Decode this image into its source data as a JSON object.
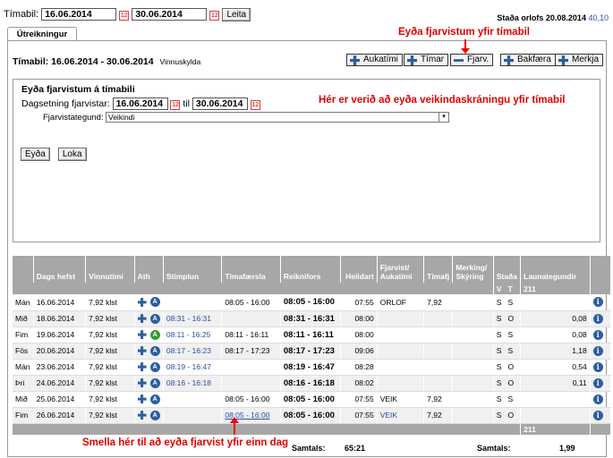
{
  "top": {
    "period_label": "Tímabil:",
    "from": "16.06.2014",
    "to": "30.06.2014",
    "search_btn": "Leita",
    "leave_status_label": "Staða orlofs 20.08.2014",
    "leave_status_value": "40,10"
  },
  "tab": "Útreikningur",
  "annot": {
    "top": "Eyða fjarvistum yfir tímabil",
    "mid": "Hér er verið að eyða veikindaskráningu yfir tímabil",
    "bottom": "Smella hér til að eyða fjarvist yfir einn dag"
  },
  "period_title": "Tímabil: 16.06.2014 - 30.06.2014",
  "period_sub": "Vinnuskylda",
  "toolbar": [
    "Aukatími",
    "Tímar",
    "Fjarv.",
    "Bakfæra",
    "Merkja"
  ],
  "form": {
    "title": "Eyða fjarvistum á tímabili",
    "dates_label": "Dagsetning fjarvistar:",
    "from": "16.06.2014",
    "til": "til",
    "to": "30.06.2014",
    "type_label": "Fjarvistategund:",
    "type_value": "Veikindi",
    "delete_btn": "Eyða",
    "close_btn": "Loka"
  },
  "grid": {
    "headers": [
      "",
      "Dags hefst",
      "Vinnutími",
      "Ath",
      "Stimplun",
      "Tímafærsla",
      "Reiknifors",
      "Heildart",
      "Fjarvist/ Aukatími",
      "Tímafj",
      "Merking/ Skýring",
      "Staða",
      "Launategundir",
      ""
    ],
    "sub": {
      "v": "V",
      "t": "T",
      "code": "211"
    },
    "rows": [
      {
        "d": "Mán",
        "date": "16.06.2014",
        "v": "7,92 klst",
        "s": "",
        "tf": "08:05 - 16:00",
        "rf": "08:05 - 16:00",
        "h": "07:55",
        "fj": "ORLOF",
        "tj": "7,92",
        "sv": "S",
        "st": "S",
        "lt": "",
        "g": false
      },
      {
        "d": "Mið",
        "date": "18.06.2014",
        "v": "7,92 klst",
        "s": "08:31 - 16:31",
        "tf": "",
        "rf": "08:31 - 16:31",
        "h": "08:00",
        "fj": "",
        "tj": "",
        "sv": "S",
        "st": "O",
        "lt": "0,08",
        "g": false
      },
      {
        "d": "Fim",
        "date": "19.06.2014",
        "v": "7,92 klst",
        "s": "08:11 - 16:25",
        "tf": "08:11 - 16:11",
        "rf": "08:11 - 16:11",
        "h": "08:00",
        "fj": "",
        "tj": "",
        "sv": "S",
        "st": "S",
        "lt": "0,08",
        "g": true
      },
      {
        "d": "Fös",
        "date": "20.06.2014",
        "v": "7,92 klst",
        "s": "08:17 - 16:23",
        "tf": "08:17 - 17:23",
        "rf": "08:17 - 17:23",
        "h": "09:06",
        "fj": "",
        "tj": "",
        "sv": "S",
        "st": "S",
        "lt": "1,18",
        "g": false
      },
      {
        "d": "Mán",
        "date": "23.06.2014",
        "v": "7,92 klst",
        "s": "08:19 - 16:47",
        "tf": "",
        "rf": "08:19 - 16:47",
        "h": "08:28",
        "fj": "",
        "tj": "",
        "sv": "S",
        "st": "O",
        "lt": "0,54",
        "g": false
      },
      {
        "d": "Þri",
        "date": "24.06.2014",
        "v": "7,92 klst",
        "s": "08:16 - 16:18",
        "tf": "",
        "rf": "08:16 - 16:18",
        "h": "08:02",
        "fj": "",
        "tj": "",
        "sv": "S",
        "st": "O",
        "lt": "0,11",
        "g": false
      },
      {
        "d": "Mið",
        "date": "25.06.2014",
        "v": "7,92 klst",
        "s": "",
        "tf": "08:05 - 16:00",
        "rf": "08:05 - 16:00",
        "h": "07:55",
        "fj": "VEIK",
        "tj": "7,92",
        "sv": "S",
        "st": "S",
        "lt": "",
        "g": false
      },
      {
        "d": "Fim",
        "date": "26.06.2014",
        "v": "7,92 klst",
        "s": "",
        "tf": "08:05 - 16:00",
        "rf": "08:05 - 16:00",
        "h": "07:55",
        "fj": "VEIK",
        "tj": "7,92",
        "sv": "S",
        "st": "O",
        "lt": "",
        "g": false,
        "link": true
      }
    ],
    "footer_code": "211",
    "total_label1": "Samtals:",
    "total_value1": "65:21",
    "total_label2": "Samtals:",
    "total_value2": "1,99"
  }
}
